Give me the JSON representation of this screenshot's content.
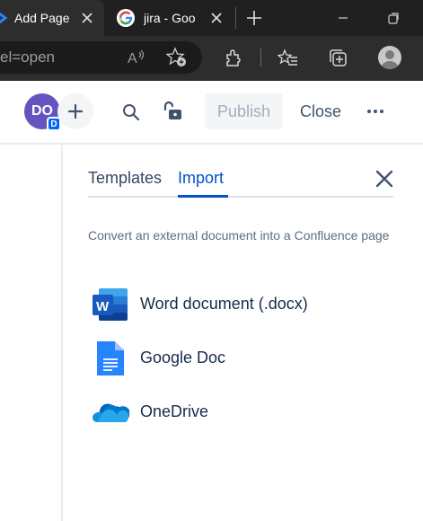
{
  "browser": {
    "tabs": [
      {
        "title": "Add Page",
        "active": true
      },
      {
        "title": "jira - Goo",
        "active": false
      }
    ],
    "address": {
      "text": "el=open"
    },
    "colors": {
      "tabstrip": "#202020",
      "toolbar": "#2d2d2d"
    }
  },
  "editor": {
    "avatar": {
      "initials": "DO",
      "badge": "D"
    },
    "publish_label": "Publish",
    "close_label": "Close"
  },
  "panel": {
    "tabs": [
      {
        "label": "Templates",
        "active": false
      },
      {
        "label": "Import",
        "active": true
      }
    ],
    "description": "Convert an external document into a Confluence page",
    "options": [
      {
        "label": "Word document (.docx)",
        "icon": "word-icon"
      },
      {
        "label": "Google Doc",
        "icon": "google-doc-icon"
      },
      {
        "label": "OneDrive",
        "icon": "onedrive-icon"
      }
    ],
    "colors": {
      "accent": "#0052cc",
      "text": "#172b4d"
    }
  }
}
